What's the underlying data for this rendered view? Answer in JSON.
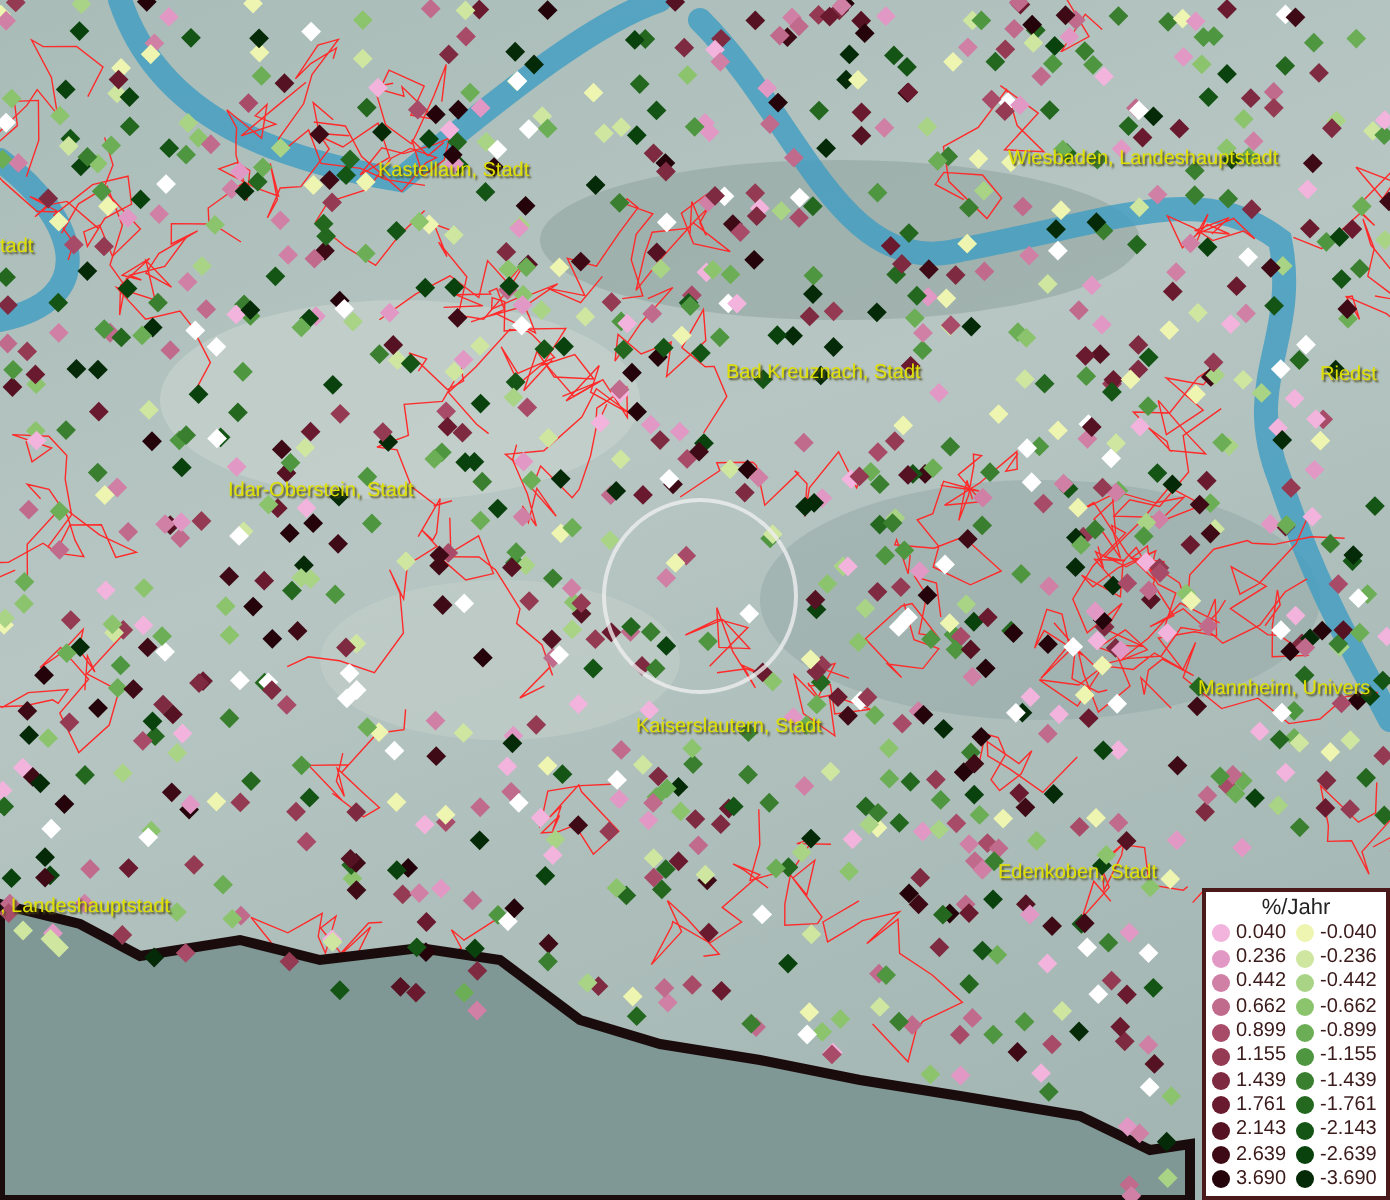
{
  "map": {
    "labels": [
      "Kastellaun, Stadt",
      "tadt",
      "Wiesbaden, Landeshauptstadt",
      "Riedst",
      "Bad Kreuznach, Stadt",
      "Idar-Oberstein, Stadt",
      "Kaiserslautern, Stadt",
      "Mannheim, Univers",
      "Edenkoben, Stadt",
      ", Landeshauptstadt"
    ]
  },
  "legend": {
    "title": "%/Jahr",
    "rows": [
      {
        "positive": {
          "label": "0.040",
          "color": "#f2b3dc"
        },
        "negative": {
          "label": "-0.040",
          "color": "#eef5b0"
        }
      },
      {
        "positive": {
          "label": "0.236",
          "color": "#e298c4"
        },
        "negative": {
          "label": "-0.236",
          "color": "#cfe6a0"
        }
      },
      {
        "positive": {
          "label": "0.442",
          "color": "#d07fa5"
        },
        "negative": {
          "label": "-0.442",
          "color": "#a9d485"
        }
      },
      {
        "positive": {
          "label": "0.662",
          "color": "#c06a8c"
        },
        "negative": {
          "label": "-0.662",
          "color": "#8cc46e"
        }
      },
      {
        "positive": {
          "label": "0.899",
          "color": "#a84b68"
        },
        "negative": {
          "label": "-0.899",
          "color": "#6cae55"
        }
      },
      {
        "positive": {
          "label": "1.155",
          "color": "#943a52"
        },
        "negative": {
          "label": "-1.155",
          "color": "#4e963f"
        }
      },
      {
        "positive": {
          "label": "1.439",
          "color": "#7e2a40"
        },
        "negative": {
          "label": "-1.439",
          "color": "#3a7f2f"
        }
      },
      {
        "positive": {
          "label": "1.761",
          "color": "#6a1a2e"
        },
        "negative": {
          "label": "-1.761",
          "color": "#246820"
        }
      },
      {
        "positive": {
          "label": "2.143",
          "color": "#551222"
        },
        "negative": {
          "label": "-2.143",
          "color": "#145516"
        }
      },
      {
        "positive": {
          "label": "2.639",
          "color": "#3e0a16"
        },
        "negative": {
          "label": "-2.639",
          "color": "#0a420e"
        }
      },
      {
        "positive": {
          "label": "3.690",
          "color": "#24040a"
        },
        "negative": {
          "label": "-3.690",
          "color": "#052a08"
        }
      }
    ]
  }
}
